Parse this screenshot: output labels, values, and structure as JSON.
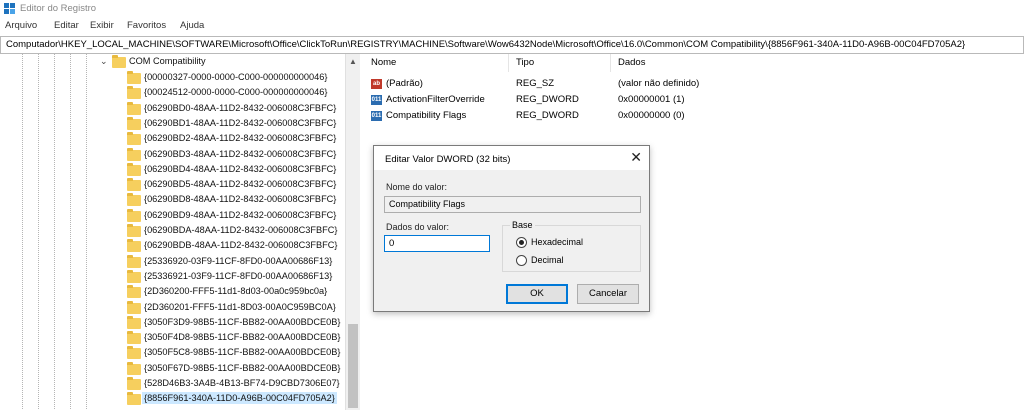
{
  "window": {
    "title": "Editor do Registro"
  },
  "menu": [
    "Arquivo",
    "Editar",
    "Exibir",
    "Favoritos",
    "Ajuda"
  ],
  "address": "Computador\\HKEY_LOCAL_MACHINE\\SOFTWARE\\Microsoft\\Office\\ClickToRun\\REGISTRY\\MACHINE\\Software\\Wow6432Node\\Microsoft\\Office\\16.0\\Common\\COM Compatibility\\{8856F961-340A-11D0-A96B-00C04FD705A2}",
  "tree": {
    "parent": "COM Compatibility",
    "expander": "⌄",
    "children": [
      "{00000327-0000-0000-C000-000000000046}",
      "{00024512-0000-0000-C000-000000000046}",
      "{06290BD0-48AA-11D2-8432-006008C3FBFC}",
      "{06290BD1-48AA-11D2-8432-006008C3FBFC}",
      "{06290BD2-48AA-11D2-8432-006008C3FBFC}",
      "{06290BD3-48AA-11D2-8432-006008C3FBFC}",
      "{06290BD4-48AA-11D2-8432-006008C3FBFC}",
      "{06290BD5-48AA-11D2-8432-006008C3FBFC}",
      "{06290BD8-48AA-11D2-8432-006008C3FBFC}",
      "{06290BD9-48AA-11D2-8432-006008C3FBFC}",
      "{06290BDA-48AA-11D2-8432-006008C3FBFC}",
      "{06290BDB-48AA-11D2-8432-006008C3FBFC}",
      "{25336920-03F9-11CF-8FD0-00AA00686F13}",
      "{25336921-03F9-11CF-8FD0-00AA00686F13}",
      "{2D360200-FFF5-11d1-8d03-00a0c959bc0a}",
      "{2D360201-FFF5-11d1-8D03-00A0C959BC0A}",
      "{3050F3D9-98B5-11CF-BB82-00AA00BDCE0B}",
      "{3050F4D8-98B5-11CF-BB82-00AA00BDCE0B}",
      "{3050F5C8-98B5-11CF-BB82-00AA00BDCE0B}",
      "{3050F67D-98B5-11CF-BB82-00AA00BDCE0B}",
      "{528D46B3-3A4B-4B13-BF74-D9CBD7306E07}",
      "{8856F961-340A-11D0-A96B-00C04FD705A2}"
    ],
    "selected_index": 21,
    "scroll_up": "▲"
  },
  "list": {
    "columns": [
      "Nome",
      "Tipo",
      "Dados"
    ],
    "rows": [
      {
        "icon": "string-value-icon",
        "icon_text": "ab",
        "name": "(Padrão)",
        "type": "REG_SZ",
        "data": "(valor não definido)"
      },
      {
        "icon": "dword-value-icon",
        "icon_text": "011",
        "name": "ActivationFilterOverride",
        "type": "REG_DWORD",
        "data": "0x00000001 (1)"
      },
      {
        "icon": "dword-value-icon",
        "icon_text": "011",
        "name": "Compatibility Flags",
        "type": "REG_DWORD",
        "data": "0x00000000 (0)"
      }
    ]
  },
  "dialog": {
    "title": "Editar Valor DWORD (32 bits)",
    "close": "✕",
    "name_label": "Nome do valor:",
    "name_value": "Compatibility Flags",
    "data_label": "Dados do valor:",
    "data_value": "0",
    "base_label": "Base",
    "hex_label": "Hexadecimal",
    "dec_label": "Decimal",
    "hex_selected": true,
    "ok": "OK",
    "cancel": "Cancelar"
  },
  "colors": {
    "accent": "#0078d7",
    "folder": "#f6cf5e",
    "selection": "#cce8ff"
  }
}
